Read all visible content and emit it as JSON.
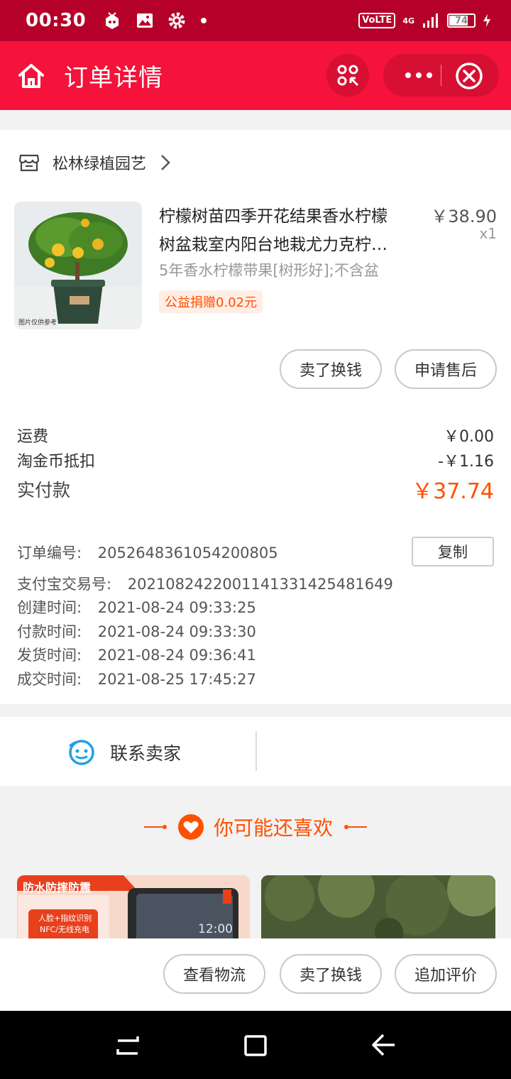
{
  "status_bar": {
    "time": "00:30",
    "network": "VoLTE",
    "signal_label": "4G",
    "battery": "74"
  },
  "header": {
    "title": "订单详情"
  },
  "shop": {
    "name": "松林绿植园艺"
  },
  "product": {
    "title_line1": "柠檬树苗四季开花结果香水柠檬",
    "title_line2": "树盆栽室内阳台地栽尤力克柠…",
    "price": "￥38.90",
    "quantity": "x1",
    "sku": "5年香水柠檬带果[树形好];不含盆",
    "charity": "公益捐赠0.02元",
    "image_watermark": "图片仅供参考"
  },
  "item_actions": {
    "sell": "卖了换钱",
    "after_sale": "申请售后"
  },
  "fees": {
    "shipping_label": "运费",
    "shipping_value": "￥0.00",
    "coin_label": "淘金币抵扣",
    "coin_value": "-￥1.16",
    "paid_label": "实付款",
    "paid_value": "￥37.74"
  },
  "order_info": {
    "order_no_label": "订单编号:",
    "order_no": "2052648361054200805",
    "copy_label": "复制",
    "alipay_label": "支付宝交易号:",
    "alipay_no": "2021082422001141331425481649",
    "created_label": "创建时间:",
    "created": "2021-08-24 09:33:25",
    "paid_label": "付款时间:",
    "paid": "2021-08-24 09:33:30",
    "shipped_label": "发货时间:",
    "shipped": "2021-08-24 09:36:41",
    "closed_label": "成交时间:",
    "closed": "2021-08-25 17:45:27"
  },
  "contact": {
    "label": "联系卖家"
  },
  "recommend": {
    "title": "你可能还喜欢",
    "card1_banner": "防水防摔防震",
    "card1_sub1": "人脸+指纹识别",
    "card1_sub2": "NFC/无线充电",
    "card1_clock": "12:00"
  },
  "bottom_actions": {
    "logistics": "查看物流",
    "sell": "卖了换钱",
    "review": "追加评价"
  },
  "colors": {
    "status_bar": "#b5002a",
    "header": "#f5123b",
    "accent": "#ff5000"
  }
}
